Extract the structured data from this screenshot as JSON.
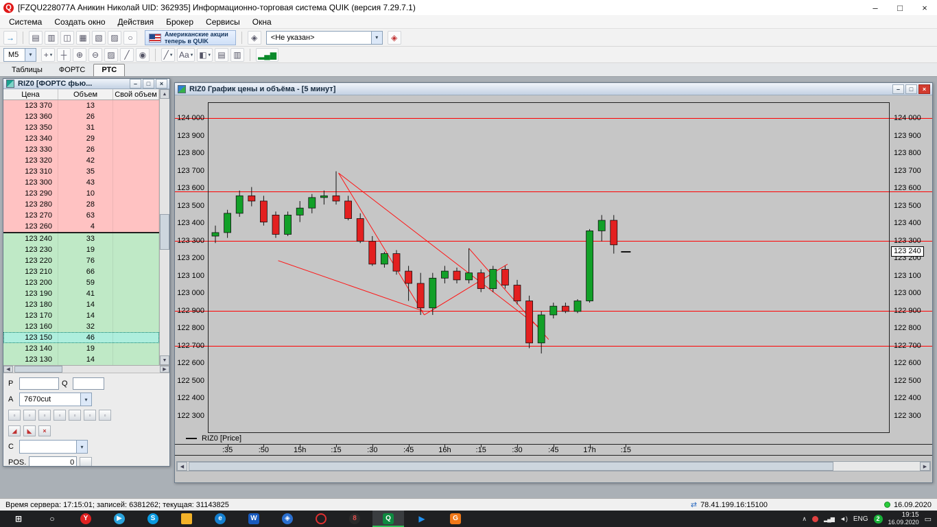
{
  "ui": {
    "dd_arrow": "▾",
    "left_arrow": "◀",
    "right_arrow": "▶",
    "up_arrow": "▲",
    "down_arrow": "▼"
  },
  "app": {
    "logo_letter": "Q",
    "title": "[FZQU228077A Аникин Николай UID: 362935] Информационно-торговая система QUIK (версия 7.29.7.1)",
    "window_controls": {
      "minimize": "–",
      "maximize": "□",
      "close": "×"
    }
  },
  "menu": {
    "items": [
      "Система",
      "Создать окно",
      "Действия",
      "Брокер",
      "Сервисы",
      "Окна"
    ],
    "slugs": [
      "system",
      "create-window",
      "actions",
      "broker",
      "services",
      "windows"
    ]
  },
  "toolbar1": {
    "left_icons": [
      {
        "name": "connect-arrow-icon",
        "glyph": "→",
        "color": "#1a7ac0"
      }
    ],
    "icons": [
      {
        "name": "print-icon",
        "glyph": "▤"
      },
      {
        "name": "export-icon",
        "glyph": "▥"
      },
      {
        "name": "new-window-icon",
        "glyph": "◫"
      },
      {
        "name": "table-icon",
        "glyph": "▦"
      },
      {
        "name": "quotes-icon",
        "glyph": "▧"
      },
      {
        "name": "news-icon",
        "glyph": "▨"
      },
      {
        "name": "search-icon",
        "glyph": "○"
      }
    ],
    "banner_line1": "Американские акции",
    "banner_line2": "теперь в QUIK",
    "strategy_icon": {
      "name": "strategy-icon",
      "glyph": "◈",
      "color": "#556"
    },
    "account_value": "<Не указан>",
    "strategy_edit_icon": {
      "name": "strategy-edit-icon",
      "glyph": "◈",
      "color": "#c03030"
    }
  },
  "toolbar2": {
    "timeframe": "M5",
    "tools": [
      {
        "name": "add-indicator-button",
        "glyph": "+",
        "dd": true
      },
      {
        "name": "cursor-move-icon",
        "glyph": "┼"
      },
      {
        "name": "zoom-in-icon",
        "glyph": "⊕"
      },
      {
        "name": "zoom-out-icon",
        "glyph": "⊖"
      },
      {
        "name": "eraser-icon",
        "glyph": "▨"
      },
      {
        "name": "pencil-icon",
        "glyph": "╱"
      },
      {
        "name": "hand-icon",
        "glyph": "◉"
      },
      {
        "type": "sep"
      },
      {
        "name": "line-tool-icon",
        "glyph": "╱",
        "dd": true
      },
      {
        "name": "text-tool-icon",
        "glyph": "Aa",
        "dd": true
      },
      {
        "name": "paint-tool-icon",
        "glyph": "◧",
        "dd": true
      },
      {
        "name": "pattern-tool-icon",
        "glyph": "▤"
      },
      {
        "name": "hatch-tool-icon",
        "glyph": "▥"
      },
      {
        "type": "sep"
      },
      {
        "name": "volume-bars-icon",
        "glyph": "▂▄▆",
        "color": "#0a8a2a"
      }
    ]
  },
  "tabs": {
    "items": [
      {
        "label": "Таблицы",
        "slug": "tables",
        "active": false
      },
      {
        "label": "ФОРТС",
        "slug": "forts",
        "active": false
      },
      {
        "label": "РТС",
        "slug": "rts",
        "active": true
      }
    ]
  },
  "orderbook": {
    "title": "RIZ0 [ФОРТС фью...",
    "columns": [
      "Цена",
      "Объем",
      "Свой объем"
    ],
    "asks": [
      [
        "123 370",
        "13"
      ],
      [
        "123 360",
        "26"
      ],
      [
        "123 350",
        "31"
      ],
      [
        "123 340",
        "29"
      ],
      [
        "123 330",
        "26"
      ],
      [
        "123 320",
        "42"
      ],
      [
        "123 310",
        "35"
      ],
      [
        "123 300",
        "43"
      ],
      [
        "123 290",
        "10"
      ],
      [
        "123 280",
        "28"
      ],
      [
        "123 270",
        "63"
      ],
      [
        "123 260",
        "4"
      ]
    ],
    "bids": [
      [
        "123 240",
        "33"
      ],
      [
        "123 230",
        "19"
      ],
      [
        "123 220",
        "76"
      ],
      [
        "123 210",
        "66"
      ],
      [
        "123 200",
        "59"
      ],
      [
        "123 190",
        "41"
      ],
      [
        "123 180",
        "14"
      ],
      [
        "123 170",
        "14"
      ],
      [
        "123 160",
        "32"
      ],
      [
        "123 150",
        "46"
      ],
      [
        "123 140",
        "19"
      ],
      [
        "123 130",
        "14"
      ]
    ],
    "selected_price": "123 150",
    "controls": {
      "p_label": "P",
      "q_label": "Q",
      "a_label": "A",
      "a_value": "7670cut",
      "c_label": "C",
      "pos_label": "POS.",
      "pos_value": "0"
    }
  },
  "chart_window": {
    "title": "RIZ0 График цены и объёма - [5 минут]",
    "legend_label": "RIZ0 [Price]",
    "current_price_label": "123 240"
  },
  "chart_data": {
    "type": "candlestick",
    "instrument": "RIZ0",
    "interval": "5 минут",
    "ylim": [
      122210,
      124090
    ],
    "up_color": "#12a028",
    "down_color": "#e32020",
    "trend_color": "#ff1515",
    "level_color": "#ff0000",
    "tick_values": [
      124000,
      123900,
      123800,
      123700,
      123600,
      123500,
      123400,
      123300,
      123200,
      123100,
      123000,
      122900,
      122800,
      122700,
      122600,
      122500,
      122400,
      122300
    ],
    "tick_labels": [
      "124 000",
      "123 900",
      "123 800",
      "123 700",
      "123 600",
      "123 500",
      "123 400",
      "123 300",
      "123 200",
      "123 100",
      "123 000",
      "122 900",
      "122 800",
      "122 700",
      "122 600",
      "122 500",
      "122 400",
      "122 300"
    ],
    "x_labels": [
      ":35",
      ":50",
      "15h",
      ":15",
      ":30",
      ":45",
      "16h",
      ":15",
      ":30",
      ":45",
      "17h",
      ":15"
    ],
    "x_label_first_candle": 1,
    "x_label_step": 3,
    "hlines": [
      124000,
      123580,
      123300,
      122900,
      122700
    ],
    "trendlines": [
      [
        [
          10.2,
          123690
        ],
        [
          17.3,
          122880
        ]
      ],
      [
        [
          10.2,
          123690
        ],
        [
          27.0,
          122800
        ]
      ],
      [
        [
          5.2,
          123190
        ],
        [
          17.3,
          122900
        ]
      ],
      [
        [
          17.3,
          122880
        ],
        [
          24.2,
          123170
        ]
      ],
      [
        [
          21.0,
          123260
        ],
        [
          27.6,
          122740
        ]
      ]
    ],
    "current_price": 123240,
    "candles": [
      [
        123330,
        123390,
        123290,
        123350
      ],
      [
        123350,
        123480,
        123320,
        123460
      ],
      [
        123460,
        123590,
        123440,
        123560
      ],
      [
        123560,
        123610,
        123500,
        123530
      ],
      [
        123530,
        123560,
        123390,
        123410
      ],
      [
        123450,
        123470,
        123320,
        123340
      ],
      [
        123340,
        123470,
        123330,
        123450
      ],
      [
        123450,
        123530,
        123410,
        123490
      ],
      [
        123490,
        123570,
        123460,
        123550
      ],
      [
        123550,
        123590,
        123510,
        123560
      ],
      [
        123560,
        123700,
        123510,
        123530
      ],
      [
        123530,
        123560,
        123420,
        123430
      ],
      [
        123430,
        123460,
        123290,
        123300
      ],
      [
        123300,
        123330,
        123160,
        123170
      ],
      [
        123170,
        123240,
        123150,
        123230
      ],
      [
        123230,
        123250,
        123110,
        123130
      ],
      [
        123130,
        123160,
        122960,
        123060
      ],
      [
        123060,
        123120,
        122880,
        122920
      ],
      [
        122920,
        123120,
        122880,
        123090
      ],
      [
        123090,
        123160,
        123060,
        123130
      ],
      [
        123130,
        123150,
        123060,
        123080
      ],
      [
        123080,
        123260,
        123060,
        123120
      ],
      [
        123120,
        123140,
        123010,
        123030
      ],
      [
        123030,
        123160,
        123010,
        123140
      ],
      [
        123140,
        123160,
        123030,
        123050
      ],
      [
        123050,
        123080,
        122940,
        122960
      ],
      [
        122960,
        122990,
        122690,
        122720
      ],
      [
        122720,
        122900,
        122660,
        122880
      ],
      [
        122880,
        122950,
        122860,
        122930
      ],
      [
        122930,
        122950,
        122890,
        122900
      ],
      [
        122900,
        122970,
        122890,
        122960
      ],
      [
        122960,
        123370,
        122950,
        123360
      ],
      [
        123360,
        123450,
        123300,
        123420
      ],
      [
        123420,
        123450,
        123230,
        123280
      ]
    ]
  },
  "status_bar": {
    "server_text": "Время сервера: 17:15:01; записей: 6381262; текущая: 31143825",
    "conn_icon": "⇄",
    "connection": "78.41.199.16:15100",
    "date": "16.09.2020"
  },
  "taskbar": {
    "apps": [
      {
        "name": "start-button",
        "glyph": "⊞",
        "bg": "none",
        "fg": "#ffffff",
        "shape": "plain"
      },
      {
        "name": "search-button",
        "glyph": "○",
        "bg": "none",
        "fg": "#ffffff",
        "shape": "plain"
      },
      {
        "name": "yandex-browser-icon",
        "glyph": "Y",
        "bg": "#e02020",
        "fg": "#ffffff",
        "shape": "circle"
      },
      {
        "name": "telegram-icon",
        "glyph": "▶",
        "bg": "#2aa3dc",
        "fg": "#ffffff",
        "shape": "circle"
      },
      {
        "name": "skype-icon",
        "glyph": "S",
        "bg": "#0a9ae0",
        "fg": "#ffffff",
        "shape": "circle"
      },
      {
        "name": "explorer-folder-icon",
        "glyph": "",
        "bg": "#f2b229",
        "fg": "#ffffff",
        "shape": "folder"
      },
      {
        "name": "edge-browser-icon",
        "glyph": "e",
        "bg": "#1580d0",
        "fg": "#ffffff",
        "shape": "circle"
      },
      {
        "name": "word-icon",
        "glyph": "W",
        "bg": "#185abd",
        "fg": "#ffffff",
        "shape": "square"
      },
      {
        "name": "app-blue-icon",
        "glyph": "◈",
        "bg": "#2a6fd0",
        "fg": "#ffffff",
        "shape": "circle"
      },
      {
        "name": "opera-browser-icon",
        "glyph": "",
        "bg": "none",
        "fg": "#e03030",
        "shape": "ring"
      },
      {
        "name": "o8-app-icon",
        "glyph": "8",
        "bg": "#2a2a2a",
        "fg": "#e05050",
        "shape": "circle"
      },
      {
        "name": "quik-icon",
        "glyph": "Q",
        "bg": "#0e8a40",
        "fg": "#ffffff",
        "shape": "square",
        "active": true
      },
      {
        "name": "media-play-icon",
        "glyph": "▶",
        "bg": "none",
        "fg": "#2090f0",
        "shape": "plain"
      },
      {
        "name": "gom-pdf-icon",
        "glyph": "G",
        "bg": "#f07818",
        "fg": "#ffffff",
        "shape": "square"
      }
    ],
    "tray": {
      "chevron": "∧",
      "network_glyph": "▂▄▆",
      "volume_glyph": "◄)",
      "lang": "ENG",
      "badge": "2",
      "time": "19:15",
      "date": "16.09.2020",
      "action_glyph": "▭"
    }
  }
}
